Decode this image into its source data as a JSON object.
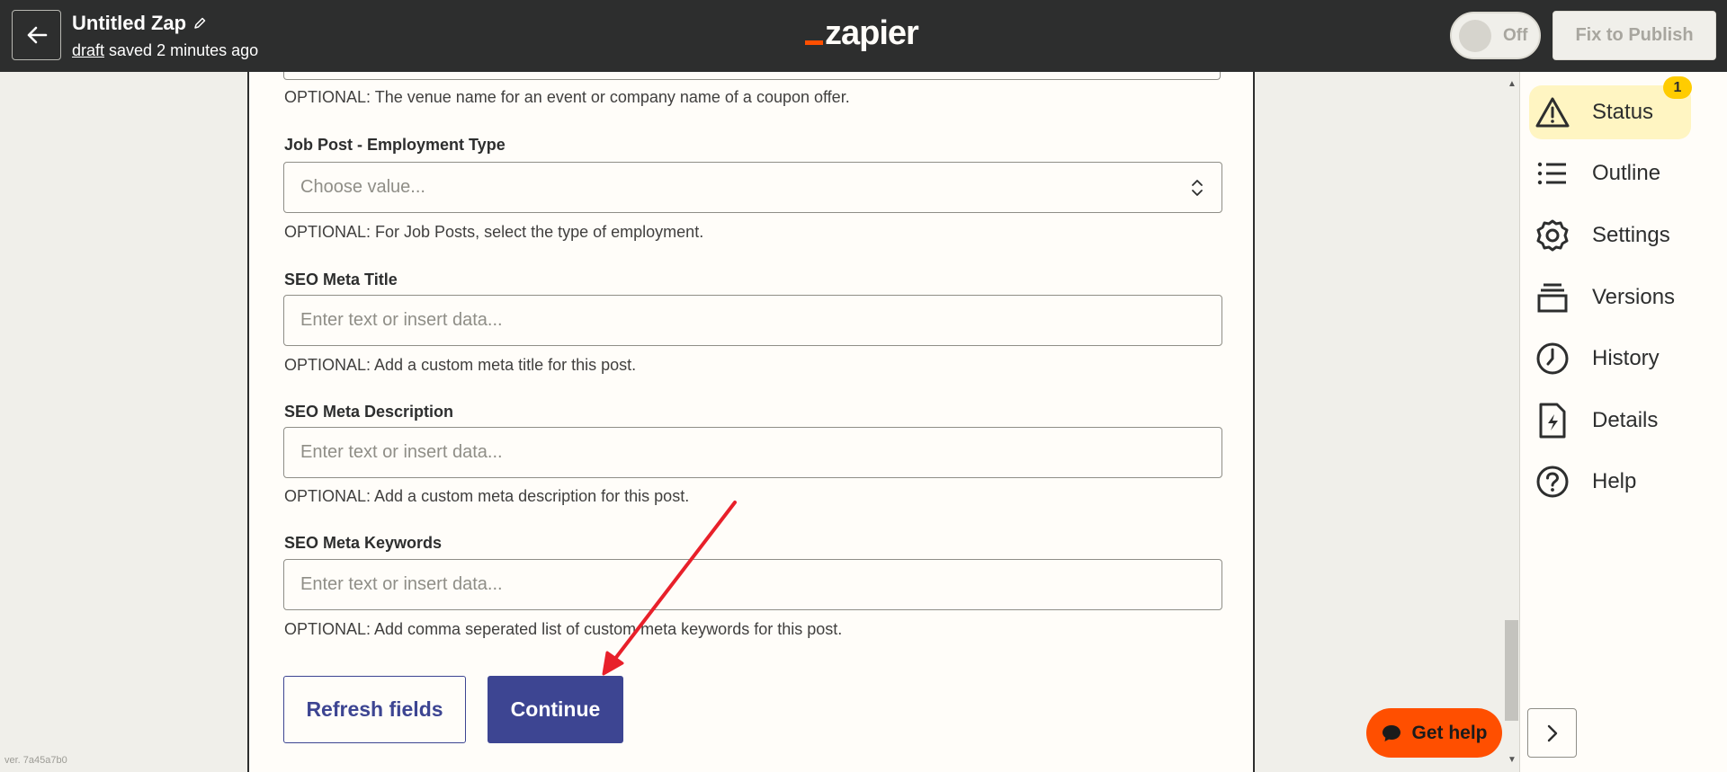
{
  "topbar": {
    "title": "Untitled Zap",
    "draft_link": "draft",
    "saved_text": " saved 2 minutes ago",
    "logo_text": "zapier",
    "toggle_label": "Off",
    "publish_label": "Fix to Publish"
  },
  "form": {
    "venue_help": "OPTIONAL: The venue name for an event or company name of a coupon offer.",
    "fields": [
      {
        "label": "Job Post - Employment Type",
        "placeholder": "Choose value...",
        "help": "OPTIONAL: For Job Posts, select the type of employment."
      },
      {
        "label": "SEO Meta Title",
        "placeholder": "Enter text or insert data...",
        "help": "OPTIONAL: Add a custom meta title for this post."
      },
      {
        "label": "SEO Meta Description",
        "placeholder": "Enter text or insert data...",
        "help": "OPTIONAL: Add a custom meta description for this post."
      },
      {
        "label": "SEO Meta Keywords",
        "placeholder": "Enter text or insert data...",
        "help": "OPTIONAL: Add comma seperated list of custom meta keywords for this post."
      }
    ],
    "refresh_label": "Refresh fields",
    "continue_label": "Continue"
  },
  "sidebar": {
    "status_badge": "1",
    "items": [
      {
        "label": "Status",
        "icon": "warning-icon"
      },
      {
        "label": "Outline",
        "icon": "list-icon"
      },
      {
        "label": "Settings",
        "icon": "gear-icon"
      },
      {
        "label": "Versions",
        "icon": "layers-icon"
      },
      {
        "label": "History",
        "icon": "clock-icon"
      },
      {
        "label": "Details",
        "icon": "file-bolt-icon"
      },
      {
        "label": "Help",
        "icon": "question-icon"
      }
    ]
  },
  "get_help_label": "Get help",
  "version_text": "ver. 7a45a7b0",
  "colors": {
    "topbar": "#2d2e2e",
    "brand_orange": "#ff4f00",
    "primary_button": "#3d4592",
    "status_highlight": "#fff5c2",
    "badge": "#ffcc00",
    "annotation_arrow": "#e8202a"
  }
}
